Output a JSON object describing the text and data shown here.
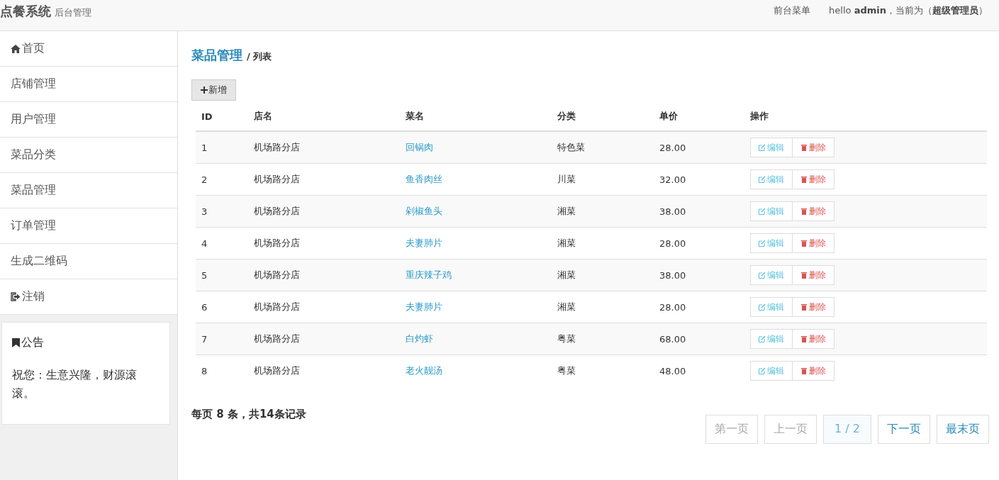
{
  "header": {
    "title": "点餐系统",
    "subtitle": "后台管理",
    "links": [
      {
        "label": "前台菜单"
      }
    ],
    "welcome": "hello **admin**，当前为（**超级管理员**）"
  },
  "sidebar": {
    "items": [
      {
        "label": "首页",
        "kind": "home"
      },
      {
        "label": "店铺管理",
        "kind": "plain"
      },
      {
        "label": "用户管理",
        "kind": "plain"
      },
      {
        "label": "菜品分类",
        "kind": "plain"
      },
      {
        "label": "菜品管理",
        "kind": "plain"
      },
      {
        "label": "订单管理",
        "kind": "plain"
      },
      {
        "label": "生成二维码",
        "kind": "plain"
      },
      {
        "label": "注销",
        "kind": "logout"
      }
    ],
    "notice": {
      "title": "公告",
      "text": "祝您：生意兴隆，财源滚滚。"
    }
  },
  "breadcrumb": {
    "section": "菜品管理",
    "page": "/ 列表"
  },
  "add_button": "新增",
  "table": {
    "columns": [
      "ID",
      "店名",
      "菜名",
      "分类",
      "单价",
      "操作"
    ],
    "rows": [
      {
        "id": "1",
        "shop": "机场路分店",
        "dish": "回锅肉",
        "category": "特色菜",
        "price": "28.00",
        "actions": [
          "编辑",
          "删除"
        ]
      },
      {
        "id": "2",
        "shop": "机场路分店",
        "dish": "鱼香肉丝",
        "category": "川菜",
        "price": "32.00",
        "actions": [
          "编辑",
          "删除"
        ]
      },
      {
        "id": "3",
        "shop": "机场路分店",
        "dish": "剁椒鱼头",
        "category": "湘菜",
        "price": "38.00",
        "actions": [
          "编辑",
          "删除"
        ]
      },
      {
        "id": "4",
        "shop": "机场路分店",
        "dish": "夫妻肺片",
        "category": "湘菜",
        "price": "28.00",
        "actions": [
          "编辑",
          "删除"
        ]
      },
      {
        "id": "5",
        "shop": "机场路分店",
        "dish": "重庆辣子鸡",
        "category": "湘菜",
        "price": "38.00",
        "actions": [
          "编辑",
          "删除"
        ]
      },
      {
        "id": "6",
        "shop": "机场路分店",
        "dish": "夫妻肺片",
        "category": "湘菜",
        "price": "28.00",
        "actions": [
          "编辑",
          "删除"
        ]
      },
      {
        "id": "7",
        "shop": "机场路分店",
        "dish": "白灼虾",
        "category": "粤菜",
        "price": "68.00",
        "actions": [
          "编辑",
          "删除"
        ]
      },
      {
        "id": "8",
        "shop": "机场路分店",
        "dish": "老火靓汤",
        "category": "粤菜",
        "price": "48.00",
        "actions": [
          "编辑",
          "删除"
        ]
      }
    ]
  },
  "summary": "每页 8 条，共14条记录",
  "pager": [
    {
      "label": "第一页",
      "disabled": true,
      "selected": false
    },
    {
      "label": "上一页",
      "disabled": true,
      "selected": false
    },
    {
      "label": "1 / 2",
      "disabled": false,
      "selected": true
    },
    {
      "label": "下一页",
      "disabled": false,
      "selected": false
    },
    {
      "label": "最末页",
      "disabled": false,
      "selected": false
    }
  ]
}
